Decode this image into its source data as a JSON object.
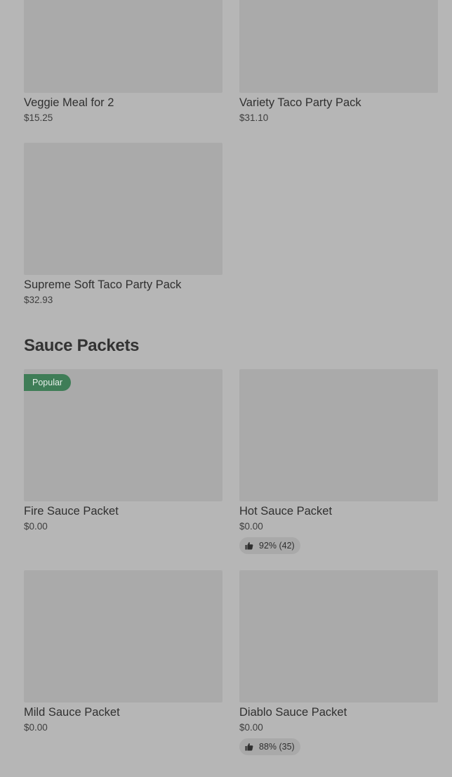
{
  "items": {
    "veggie_meal": {
      "name": "Veggie Meal for 2",
      "price": "$15.25"
    },
    "variety_taco": {
      "name": "Variety Taco Party Pack",
      "price": "$31.10"
    },
    "supreme_soft_taco": {
      "name": "Supreme Soft Taco Party Pack",
      "price": "$32.93"
    }
  },
  "sauce_section": {
    "title": "Sauce Packets",
    "items": [
      {
        "name": "Fire Sauce Packet",
        "price": "$0.00",
        "badge": "Popular"
      },
      {
        "name": "Hot Sauce Packet",
        "price": "$0.00",
        "rating": "92% (42)"
      },
      {
        "name": "Mild Sauce Packet",
        "price": "$0.00"
      },
      {
        "name": "Diablo Sauce Packet",
        "price": "$0.00",
        "rating": "88% (35)"
      }
    ]
  },
  "colors": {
    "background": "#b6b6b6",
    "image_placeholder": "#aaaaaa",
    "badge_green": "#3f7d57",
    "rating_pill": "#a9a9a9"
  }
}
